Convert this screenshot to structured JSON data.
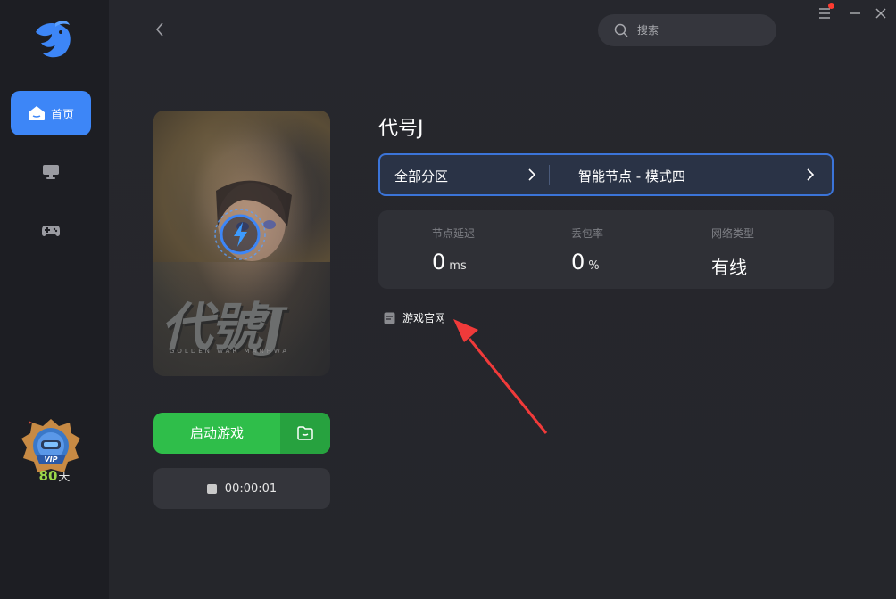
{
  "sidebar": {
    "items": [
      {
        "label": "首页",
        "icon": "home-icon",
        "active": true
      },
      {
        "label": "",
        "icon": "monitor-icon",
        "active": false
      },
      {
        "label": "",
        "icon": "gamepad-icon",
        "active": false
      }
    ],
    "vip": {
      "badge_text": "VIP",
      "days": "80",
      "unit": "天"
    }
  },
  "header": {
    "search": {
      "placeholder": "搜索"
    }
  },
  "game": {
    "title": "代号J",
    "cover_art_text": "代號J",
    "cover_art_sub": "GOLDEN WAR MANHWA",
    "start_button": "启动游戏",
    "timer": "00:00:01",
    "server": {
      "region": "全部分区",
      "node": "智能节点 - 模式四"
    },
    "stats": [
      {
        "label": "节点延迟",
        "value": "0",
        "unit": "ms"
      },
      {
        "label": "丢包率",
        "value": "0",
        "unit": "%"
      },
      {
        "label": "网络类型",
        "value": "有线",
        "unit": ""
      }
    ],
    "official_site": "游戏官网"
  },
  "colors": {
    "accent": "#3d86f7",
    "start_green": "#2fbe4a",
    "vip_days": "#9bd84a",
    "annotation_arrow": "#f03a3a",
    "notification": "#ff3b30"
  }
}
